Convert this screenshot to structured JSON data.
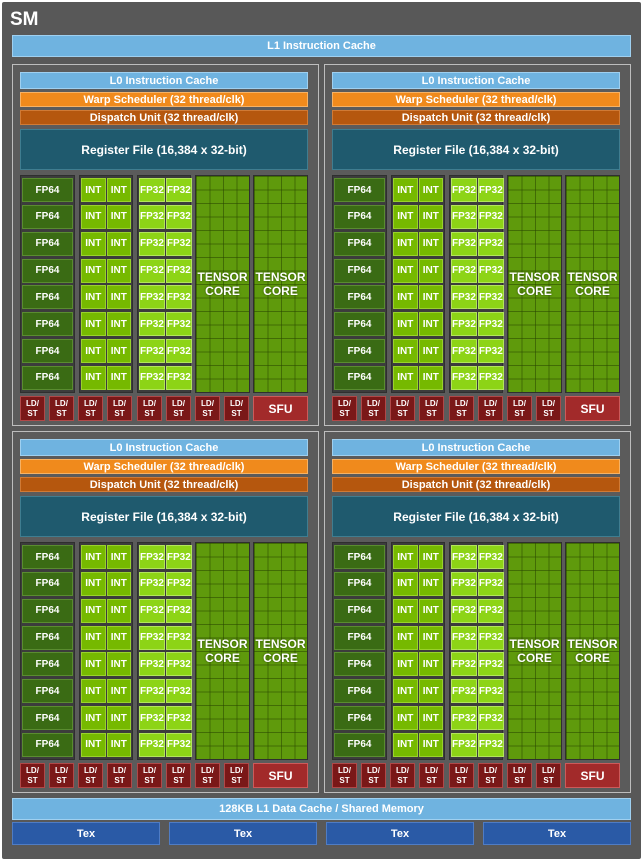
{
  "sm_title": "SM",
  "l1_instruction_cache": "L1 Instruction Cache",
  "l0_instruction_cache": "L0 Instruction Cache",
  "warp_scheduler": "Warp Scheduler (32 thread/clk)",
  "dispatch_unit": "Dispatch Unit (32 thread/clk)",
  "register_file": "Register File (16,384 x 32-bit)",
  "fp64_label": "FP64",
  "int_label": "INT",
  "fp32_label": "FP32",
  "tensor_core_label": "TENSOR\nCORE",
  "ldst_label": "LD/\nST",
  "sfu_label": "SFU",
  "l1_data_cache": "128KB L1 Data Cache / Shared Memory",
  "tex_units": [
    "Tex",
    "Tex",
    "Tex",
    "Tex"
  ],
  "partitions": 4,
  "rows_per_partition": 8,
  "tensor_cores_per_partition": 2,
  "ldst_per_partition": 8,
  "colors": {
    "background": "#585858",
    "cache": "#6fb3e0",
    "warp_scheduler": "#f08a1c",
    "dispatch_unit": "#b5570e",
    "register_file": "#1f5a6e",
    "fp64": "#3a6b14",
    "int": "#76b900",
    "fp32": "#8dd416",
    "tensor": "#5f9a0c",
    "ldst": "#7a1818",
    "sfu": "#a22a2a",
    "tex": "#2a5aa6"
  }
}
